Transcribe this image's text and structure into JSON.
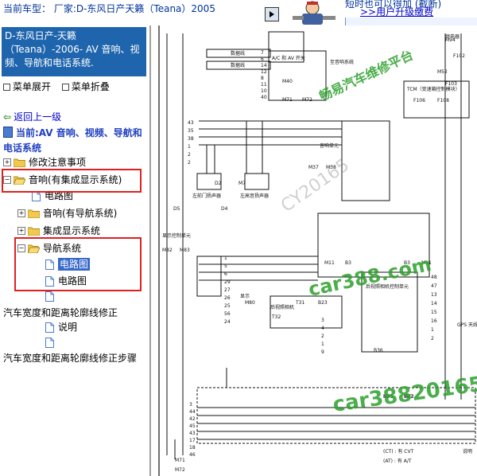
{
  "header": {
    "vehicle_label": "当前车型： 厂家:D-东风日产天籁（Teana）2005",
    "top_note": "短时也可以得加 (截断)",
    "upgrade_link": ">>用户升级缴费",
    "colors": {
      "title_bg": "#1f65ad",
      "link": "#0000cc",
      "highlight": "#e02020"
    }
  },
  "sidebar": {
    "title": "D-东风日产-天籁（Teana）-2006- AV 音响、视频、导航和电话系统.",
    "expand_label": "菜单展开",
    "collapse_label": "菜单折叠",
    "back_label": "返回上一级",
    "current_label": "当前:AV 音响、视频、导航和电话系统",
    "tree": [
      {
        "label": "修改注意事项"
      },
      {
        "label": "音响(有集成显示系统)"
      },
      {
        "label": "电路图"
      },
      {
        "label": "音响(有导航系统)"
      },
      {
        "label": "集成显示系统"
      },
      {
        "label": "导航系统"
      },
      {
        "label": "电路图"
      },
      {
        "label": "电路图"
      },
      {
        "label": ""
      },
      {
        "label": "汽车宽度和距离轮廓线修正"
      },
      {
        "label": "说明"
      },
      {
        "label": "汽车宽度和距离轮廓线修正步骤"
      }
    ]
  },
  "diagram": {
    "watermarks": [
      "畅易汽车维修平台",
      "CY20165",
      "car388.com",
      "car388201650"
    ],
    "labels": {
      "data_line": "数据线",
      "av_switch": "A/C 和 AV 开关",
      "to_audio": "至音响系统",
      "tcm": "TCM（变速箱控制模块）",
      "relay": "继电器",
      "audio_unit": "音响单元",
      "left_door_speaker": "左前门扬声器",
      "left_tweeter": "左高音扬声器",
      "display_control_unit": "显示控制单元",
      "display": "显示",
      "rear_camera": "后视照相机",
      "rear_camera_ctrl": "后视照相机控制单元",
      "gps": "GPS 天线",
      "cvt_note": "有 CVT",
      "at_note": "有 A/T"
    },
    "connectors": [
      "M40",
      "M71",
      "M72",
      "M37",
      "M38",
      "D2",
      "M7",
      "D5",
      "D4",
      "M82",
      "M83",
      "M80",
      "T32",
      "T31",
      "B23",
      "B36",
      "B16",
      "B17",
      "M11",
      "B3",
      "B3",
      "M11",
      "M94",
      "F102",
      "M52",
      "F103",
      "F106",
      "F108",
      "M71",
      "M72",
      "M71",
      "M72"
    ],
    "pins": [
      "7",
      "6",
      "14",
      "12",
      "8",
      "11",
      "10",
      "40",
      "43",
      "35",
      "38",
      "1",
      "2",
      "2",
      "1",
      "5",
      "6",
      "29",
      "27",
      "26",
      "25",
      "56",
      "24",
      "3",
      "44",
      "42",
      "45",
      "43",
      "17",
      "18",
      "46",
      "48",
      "47",
      "13",
      "14",
      "15",
      "16",
      "1",
      "2",
      "3",
      "4",
      "2",
      "1",
      "9"
    ],
    "legend": [
      "(CT) : 有 CVT",
      "(AT) : 有 A/T",
      "说明"
    ]
  }
}
